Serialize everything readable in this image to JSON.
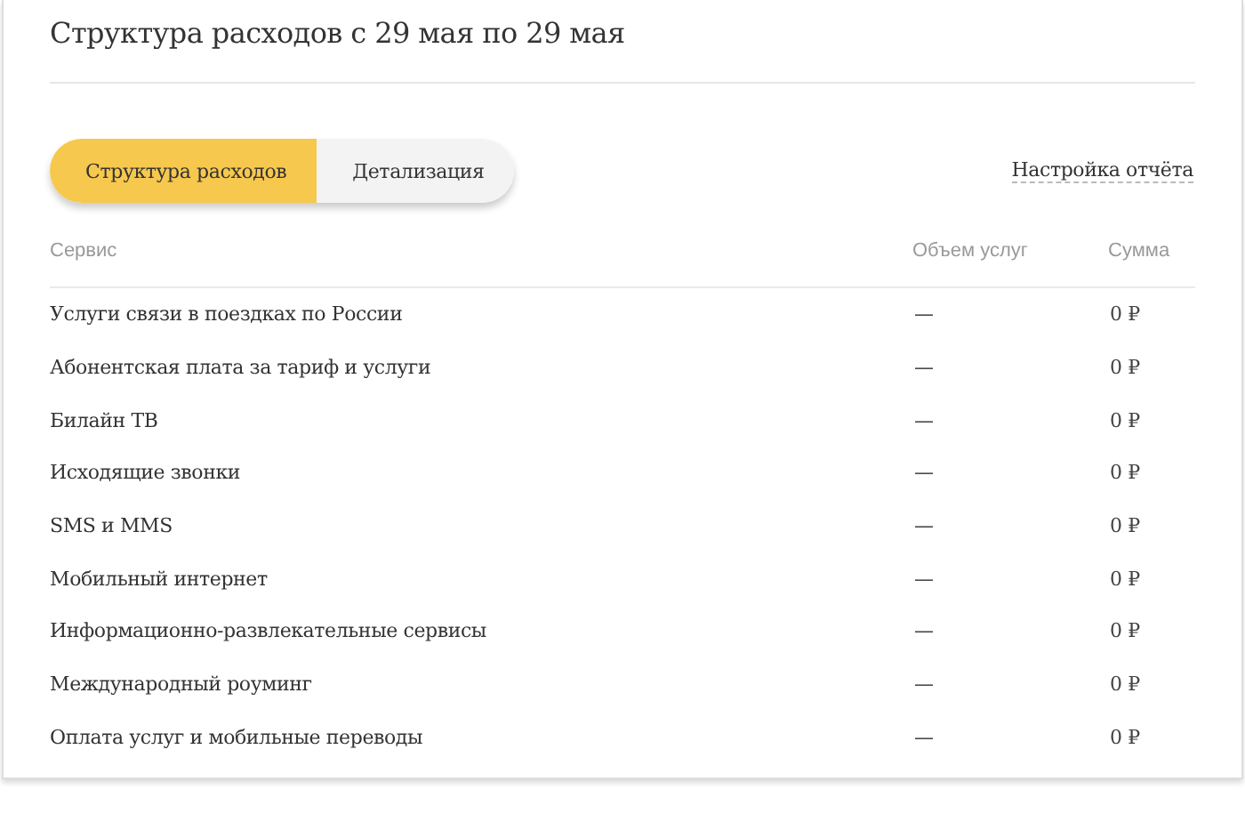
{
  "title": "Структура расходов с 29 мая по 29 мая",
  "tabs": [
    {
      "label": "Структура расходов",
      "selected": true
    },
    {
      "label": "Детализация",
      "selected": false
    }
  ],
  "report_settings_link": "Настройка отчёта",
  "table": {
    "columns": [
      "Сервис",
      "Объем услуг",
      "Сумма"
    ],
    "rows": [
      [
        "Услуги связи в поездках по России",
        "—",
        "0 ₽"
      ],
      [
        "Абонентская плата за тариф и услуги",
        "—",
        "0 ₽"
      ],
      [
        "Билайн ТВ",
        "—",
        "0 ₽"
      ],
      [
        "Исходящие звонки",
        "—",
        "0 ₽"
      ],
      [
        "SMS и MMS",
        "—",
        "0 ₽"
      ],
      [
        "Мобильный интернет",
        "—",
        "0 ₽"
      ],
      [
        "Информационно-развлекательные сервисы",
        "—",
        "0 ₽"
      ],
      [
        "Международный роуминг",
        "—",
        "0 ₽"
      ],
      [
        "Оплата услуг и мобильные переводы",
        "—",
        "0 ₽"
      ]
    ]
  }
}
